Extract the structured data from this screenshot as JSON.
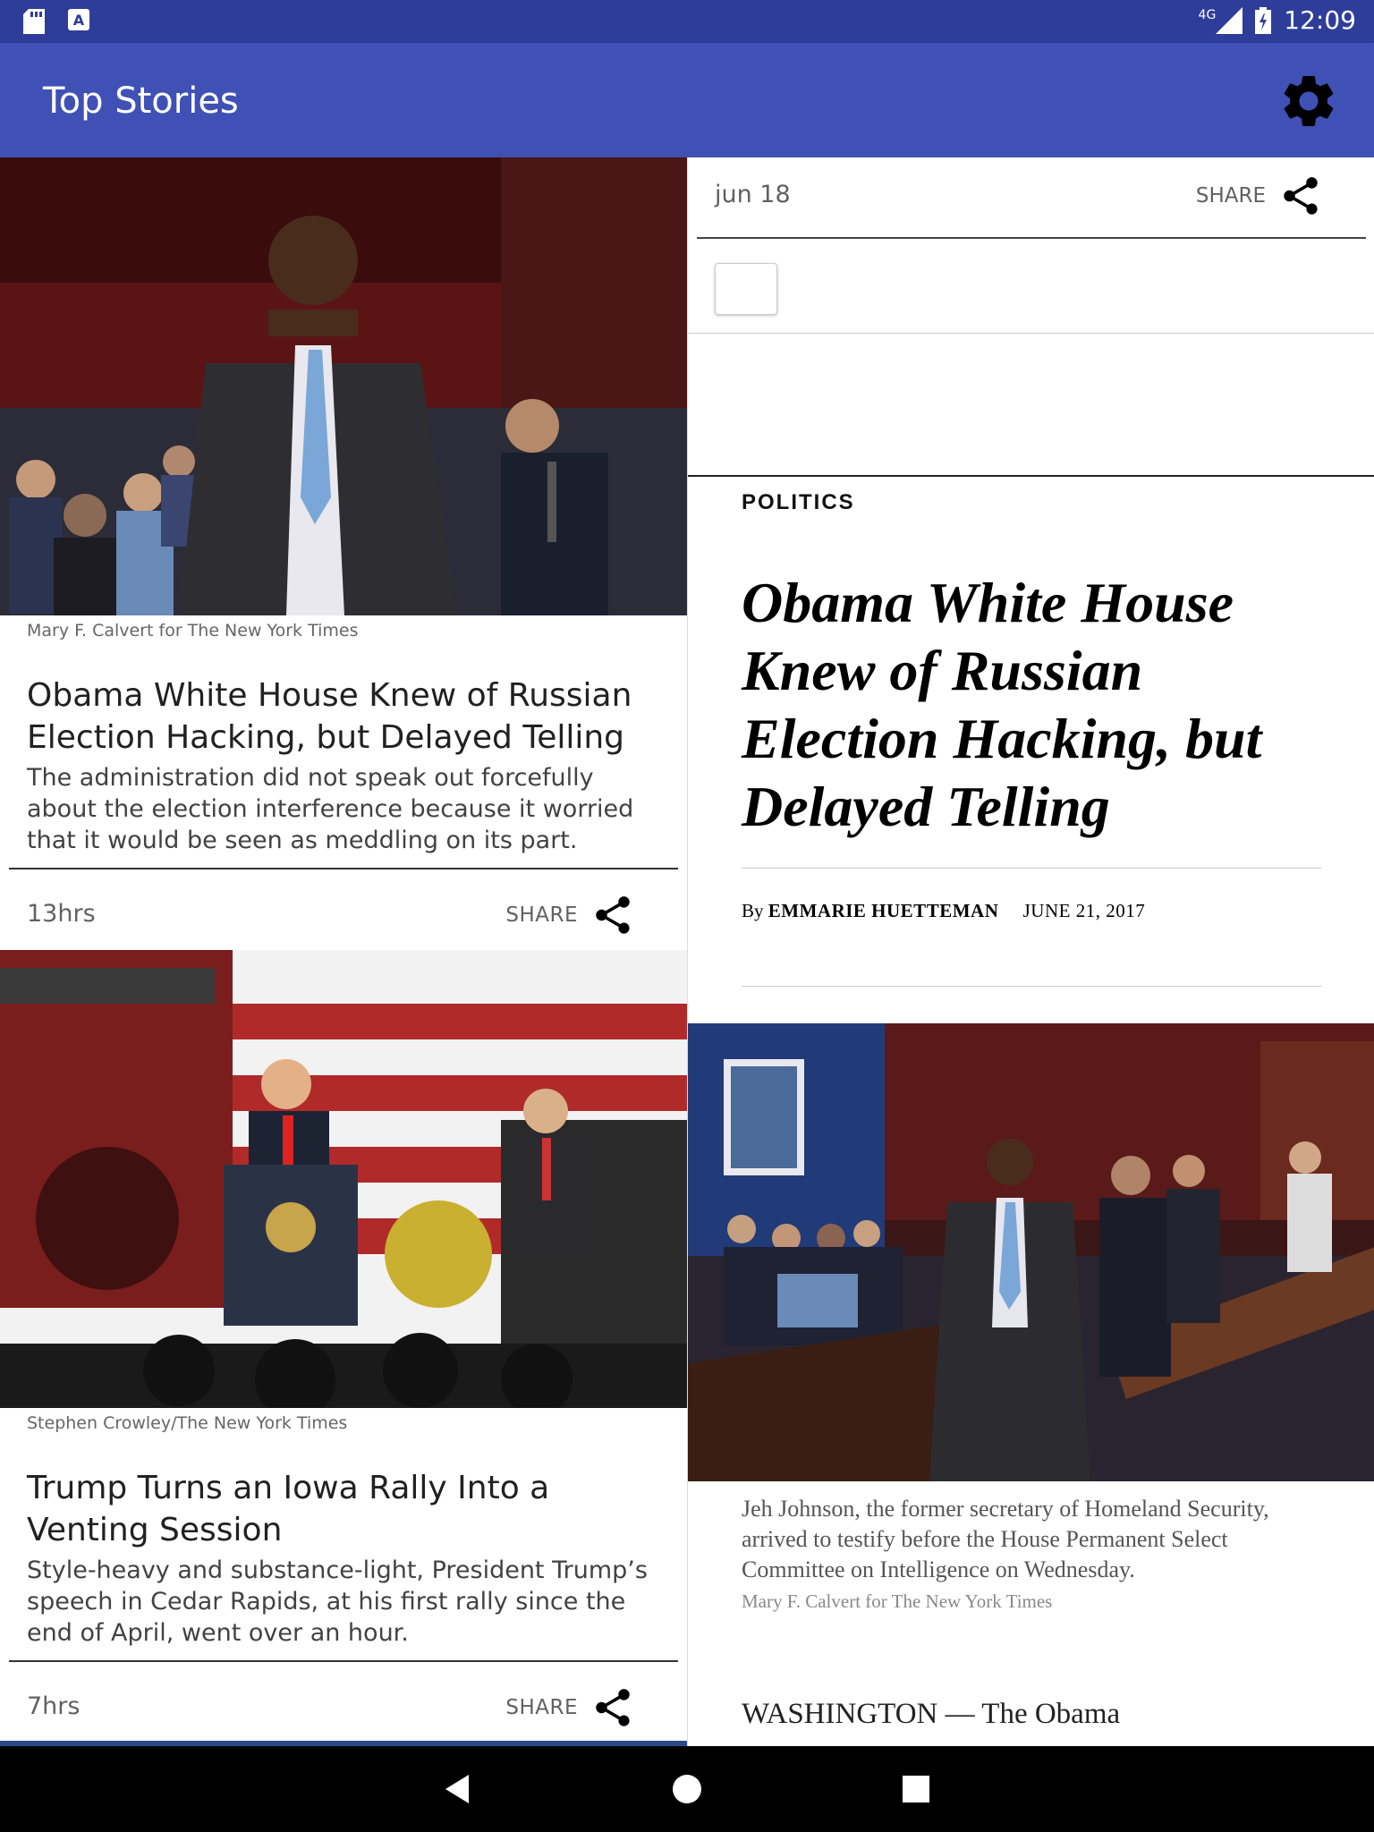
{
  "status_bar": {
    "time": "12:09",
    "network": "4G",
    "icons": [
      "sd-card-icon",
      "text-a-icon",
      "signal-icon",
      "battery-icon"
    ]
  },
  "app_bar": {
    "title": "Top Stories",
    "settings_icon": "gear-icon",
    "color": "#3f51b5"
  },
  "stories": [
    {
      "photo_credit": "Mary F. Calvert for The New York Times",
      "headline": "Obama White House Knew of Russian Election Hacking, but Delayed Telling",
      "abstract": "The administration did not speak out forcefully about the election interference because it worried that it would be seen as meddling on its part.",
      "age": "13hrs",
      "share_label": "SHARE"
    },
    {
      "photo_credit": "Stephen Crowley/The New York Times",
      "headline": "Trump Turns an Iowa Rally Into a Venting Session",
      "abstract": "Style-heavy and substance-light, President Trump’s speech in Cedar Rapids, at his first rally since the end of April, went over an hour.",
      "age": "7hrs",
      "share_label": "SHARE"
    }
  ],
  "article": {
    "date": "jun 18",
    "share_label": "SHARE",
    "section": "POLITICS",
    "headline": "Obama White House Knew of Russian Election Hacking, but Delayed Telling",
    "byline_prefix": "By",
    "author": "EMMARIE HUETTEMAN",
    "published": "JUNE 21, 2017",
    "photo_caption": "Jeh Johnson, the former secretary of Homeland Security, arrived to testify before the House Permanent Select Committee on Intelligence on Wednesday.",
    "photo_credit": "Mary F. Calvert for The New York Times",
    "lede": "WASHINGTON — The Obama"
  },
  "nav_bar": {
    "icons": [
      "back-icon",
      "home-icon",
      "recents-icon"
    ]
  }
}
